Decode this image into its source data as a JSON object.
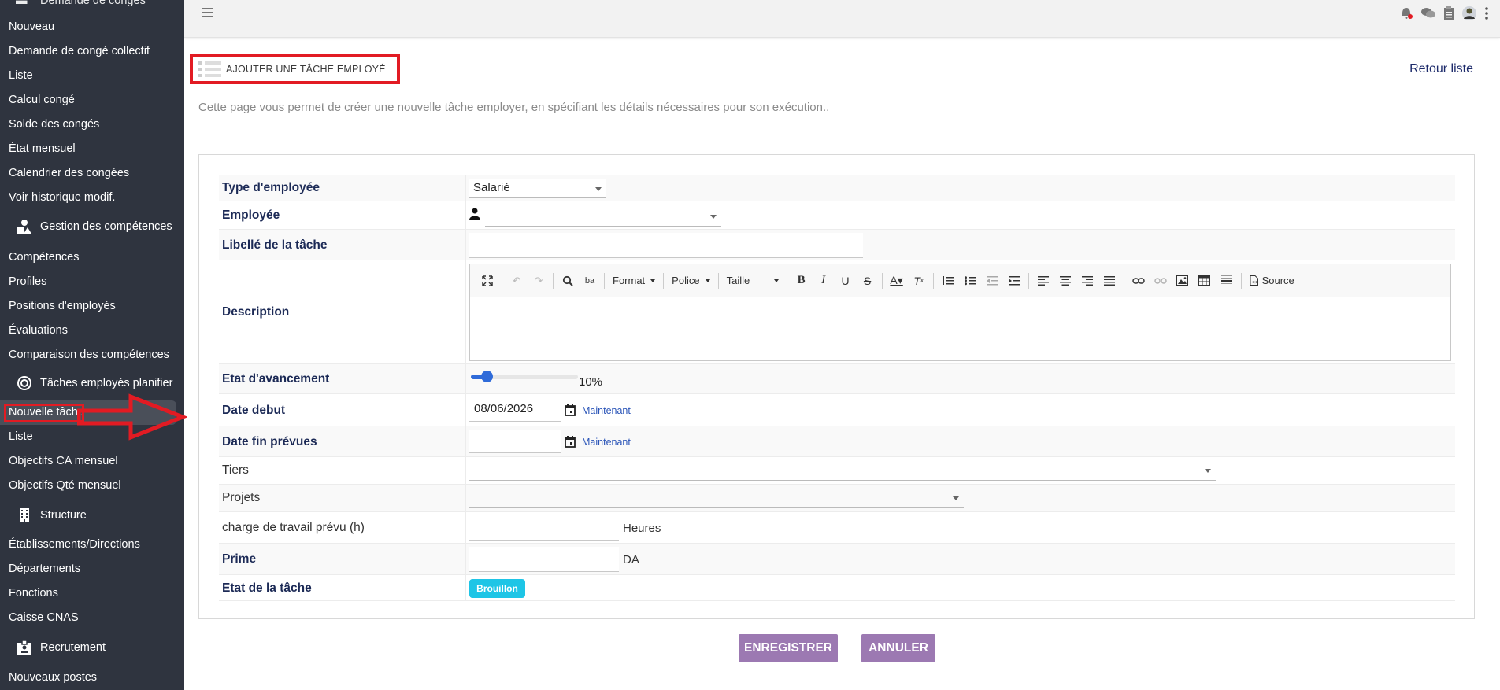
{
  "sidebar": {
    "top_cut_label": "Demande de congés",
    "leave_items": [
      "Nouveau",
      "Demande de congé collectif",
      "Liste",
      "Calcul congé",
      "Solde des congés",
      "État mensuel",
      "Calendrier des congées",
      "Voir historique modif."
    ],
    "group_competences": "Gestion des compétences",
    "competence_items": [
      "Compétences",
      "Profiles",
      "Positions d'employés",
      "Évaluations",
      "Comparaison des compétences"
    ],
    "group_taches": "Tâches employés planifier",
    "task_items": [
      "Nouvelle tâche",
      "Liste",
      "Objectifs CA mensuel",
      "Objectifs Qté mensuel"
    ],
    "group_structure": "Structure",
    "structure_items": [
      "Établissements/Directions",
      "Départements",
      "Fonctions",
      "Caisse CNAS"
    ],
    "group_recrutement": "Recrutement",
    "recruit_items": [
      "Nouveaux postes"
    ]
  },
  "header": {
    "title": "AJOUTER UNE TÂCHE EMPLOYÉ",
    "back_link": "Retour liste",
    "intro": "Cette page vous permet de créer une nouvelle tâche employer, en spécifiant les détails nécessaires pour son exécution.."
  },
  "form": {
    "employee_type_label": "Type d'employée",
    "employee_type_value": "Salarié",
    "employee_label": "Employée",
    "task_name_label": "Libellé de la tâche",
    "description_label": "Description",
    "progress_label": "Etat d'avancement",
    "progress_value": 0.1,
    "progress_text": "10%",
    "start_date_label": "Date debut",
    "start_date_value": "08/06/2026",
    "end_date_label": "Date fin prévues",
    "now_label": "Maintenant",
    "tiers_label": "Tiers",
    "projects_label": "Projets",
    "workload_label": "charge de travail prévu (h)",
    "workload_unit": "Heures",
    "bonus_label": "Prime",
    "bonus_unit": "DA",
    "status_label": "Etat de la tâche",
    "status_badge": "Brouillon"
  },
  "editor": {
    "format": "Format",
    "font": "Police",
    "size": "Taille",
    "source": "Source"
  },
  "actions": {
    "save": "ENREGISTRER",
    "cancel": "ANNULER"
  },
  "colors": {
    "sidebar_bg": "#2f343f",
    "accent_purple": "#9c79b2",
    "badge_cyan": "#1ec5e6",
    "highlight_red": "#e21b23"
  }
}
